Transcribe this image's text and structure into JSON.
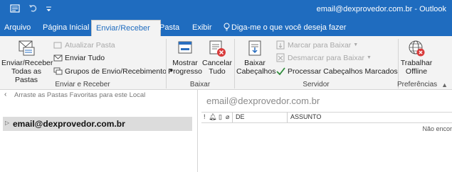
{
  "titlebar": {
    "title": "email@dexprovedor.com.br  -  Outlook",
    "icons": [
      "send-receive-all-icon",
      "undo-icon",
      "customize-quick-access-icon"
    ]
  },
  "tabs": [
    {
      "label": "Arquivo"
    },
    {
      "label": "Página Inicial"
    },
    {
      "label": "Enviar/Receber",
      "active": true
    },
    {
      "label": "Pasta"
    },
    {
      "label": "Exibir"
    },
    {
      "label": "Diga-me o que você deseja fazer"
    }
  ],
  "ribbon": {
    "enviar_receber": {
      "group_label": "Enviar e Receber",
      "big_label": [
        "Enviar/Receber",
        "Todas as Pastas"
      ],
      "atualizar": "Atualizar Pasta",
      "enviar_tudo": "Enviar Tudo",
      "grupos": "Grupos de Envio/Recebimento"
    },
    "baixar": {
      "group_label": "Baixar",
      "mostrar": [
        "Mostrar",
        "Progresso"
      ],
      "cancelar": [
        "Cancelar",
        "Tudo"
      ]
    },
    "servidor": {
      "group_label": "Servidor",
      "baixar_cab": [
        "Baixar",
        "Cabeçalhos"
      ],
      "marcar": "Marcar para Baixar",
      "desmarcar": "Desmarcar para Baixar",
      "processar": "Processar Cabeçalhos Marcados"
    },
    "preferencias": {
      "group_label": "Preferências",
      "trabalhar": [
        "Trabalhar",
        "Offline"
      ]
    }
  },
  "left": {
    "favorites_hint": "Arraste as Pastas Favoritas para este Local",
    "account": "email@dexprovedor.com.br"
  },
  "right": {
    "account": "email@dexprovedor.com.br",
    "columns": {
      "de": "DE",
      "assunto": "ASSUNTO"
    },
    "empty_message": "Não encor"
  },
  "colors": {
    "accent": "#1f6cbf",
    "ribbon_bg": "#f3f3f3"
  }
}
